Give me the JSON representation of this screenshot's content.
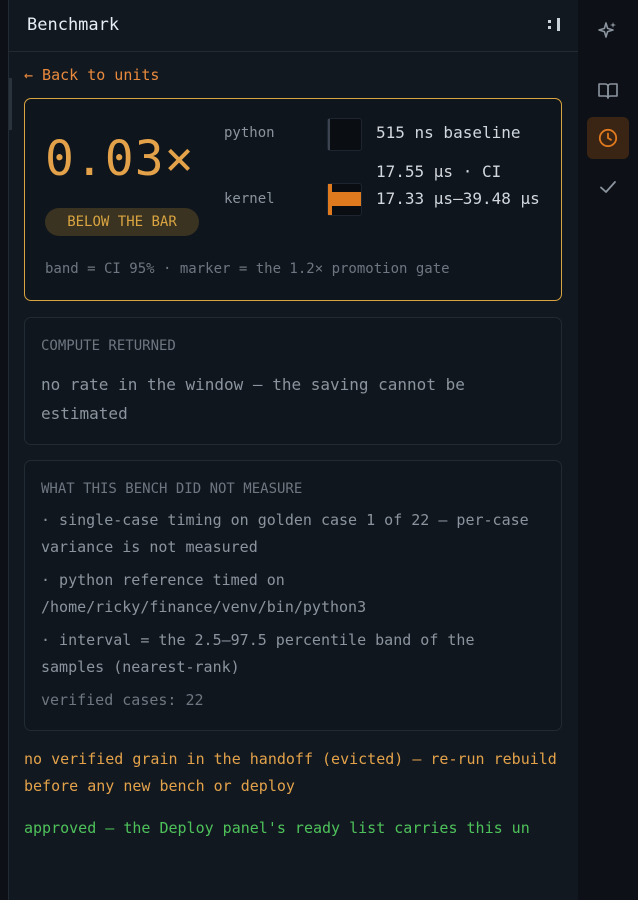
{
  "panel": {
    "title": "Benchmark",
    "back_label": "← Back to units"
  },
  "hero": {
    "ratio": "0.03×",
    "badge": "BELOW THE BAR",
    "python_label": "python",
    "python_value": "515 ns baseline",
    "kernel_label": "kernel",
    "kernel_value": "17.55 μs · CI 17.33 μs–39.48 μs",
    "legend_note": "band = CI 95% · marker = the 1.2× promotion gate"
  },
  "compute_card": {
    "caption": "COMPUTE RETURNED",
    "message": "no rate in the window — the saving cannot be estimated"
  },
  "limits_card": {
    "caption": "WHAT THIS BENCH DID NOT MEASURE",
    "bullets": [
      "· single-case timing on golden case 1 of 22 — per-case variance is not measured",
      "· python reference timed on /home/ricky/finance/venv/bin/python3",
      "· interval = the 2.5–97.5 percentile band of the samples (nearest-rank)"
    ],
    "verified": "verified cases: 22"
  },
  "warning": "no verified grain in the handoff (evicted) — re-run rebuild before any new bench or deploy",
  "approved": "approved — the Deploy panel's ready list carries this un",
  "rail": {
    "icons": [
      "sparkle-icon",
      "book-icon",
      "clock-icon",
      "check-icon"
    ],
    "active": "clock-icon"
  },
  "colors": {
    "accent": "#e3a24a",
    "orange": "#e07a1f",
    "success": "#4ec25a",
    "active_bg": "#3a2414"
  }
}
